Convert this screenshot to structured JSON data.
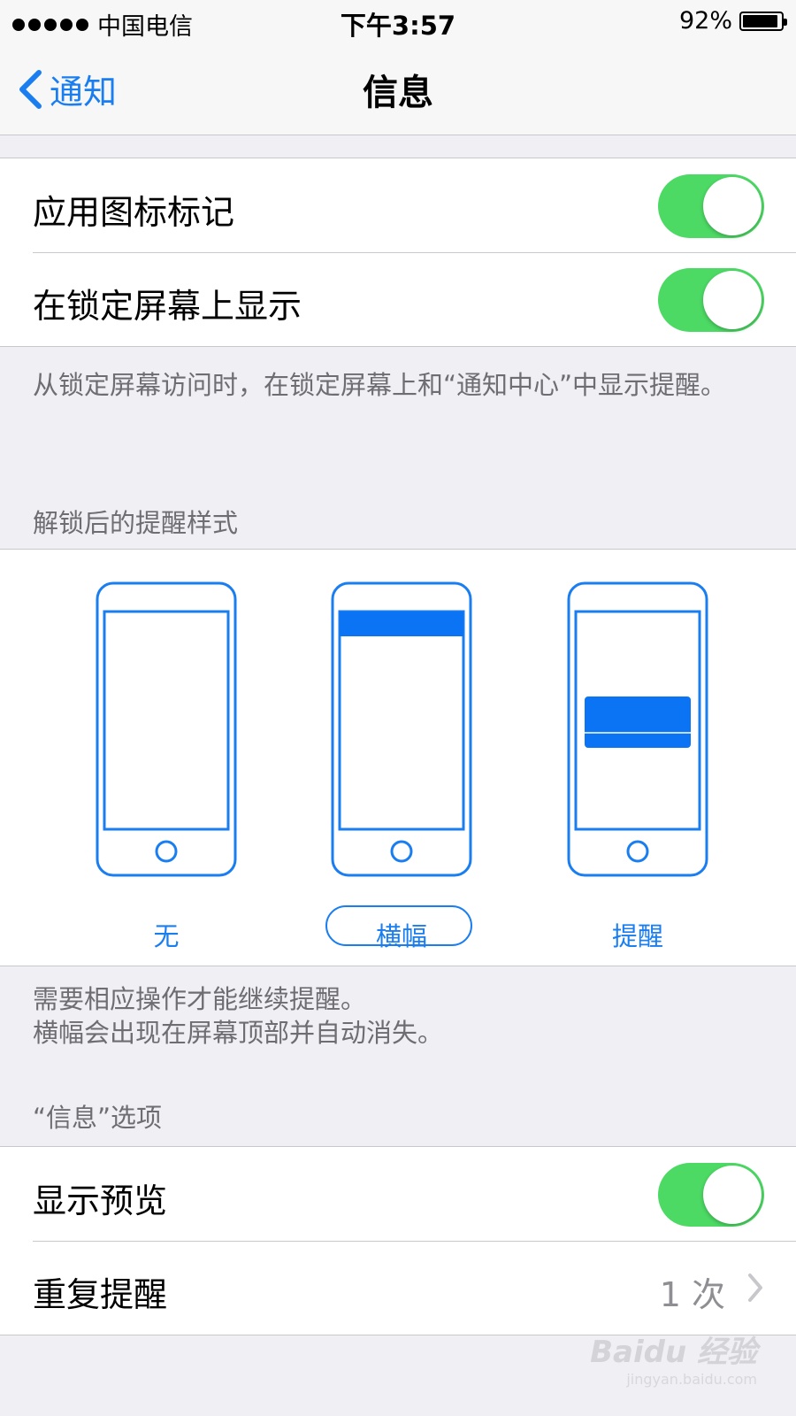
{
  "status_bar": {
    "carrier": "中国电信",
    "time": "下午3:57",
    "battery": "92%",
    "battery_level": 0.92
  },
  "nav": {
    "back_label": "通知",
    "title": "信息"
  },
  "group1": {
    "rows": [
      {
        "label": "应用图标标记",
        "on": true
      },
      {
        "label": "在锁定屏幕上显示",
        "on": true
      }
    ],
    "footer": "从锁定屏幕访问时，在锁定屏幕上和“通知中心”中显示提醒。"
  },
  "alert_style": {
    "header": "解锁后的提醒样式",
    "options": [
      {
        "label": "无"
      },
      {
        "label": "横幅",
        "selected": true
      },
      {
        "label": "提醒"
      }
    ],
    "footer_line1": "需要相应操作才能继续提醒。",
    "footer_line2": "横幅会出现在屏幕顶部并自动消失。"
  },
  "options": {
    "header": "“信息”选项",
    "show_preview": {
      "label": "显示预览",
      "on": true
    },
    "repeat": {
      "label": "重复提醒",
      "value": "1 次"
    }
  },
  "watermark": {
    "logo": "Baidu 经验",
    "url": "jingyan.baidu.com"
  },
  "colors": {
    "accent": "#1a7ef0",
    "toggle_on": "#4cd964",
    "background": "#efeff4"
  }
}
